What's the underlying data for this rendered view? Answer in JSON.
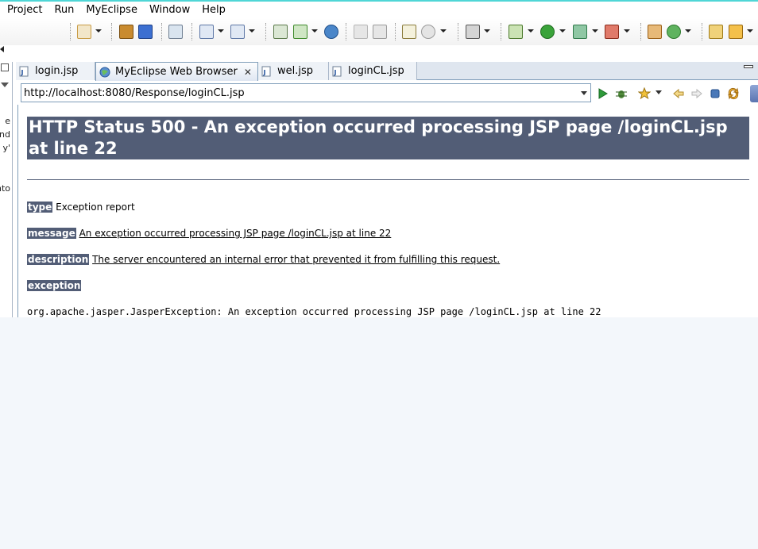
{
  "menu": [
    "Project",
    "Run",
    "MyEclipse",
    "Window",
    "Help"
  ],
  "left_panel_fragments": [
    "e",
    "nd",
    "y'",
    "nto"
  ],
  "tabs": [
    {
      "label": "login.jsp",
      "icon": "jsp-file-icon"
    },
    {
      "label": "MyEclipse Web Browser",
      "icon": "globe-icon",
      "active": true
    },
    {
      "label": "wel.jsp",
      "icon": "jsp-file-icon"
    },
    {
      "label": "loginCL.jsp",
      "icon": "jsp-file-icon"
    }
  ],
  "browser": {
    "url": "http://localhost:8080/Response/loginCL.jsp"
  },
  "page": {
    "title": "HTTP Status 500 - An exception occurred processing JSP page /loginCL.jsp at line 22",
    "type_label": "type",
    "type_value": "Exception report",
    "message_label": "message",
    "message_value": "An exception occurred processing JSP page /loginCL.jsp at line 22",
    "description_label": "description",
    "description_value": "The server encountered an internal error that prevented it from fulfilling this request.",
    "exception_label": "exception",
    "exception_text": "org.apache.jasper.JasperException: An exception occurred processing JSP page /loginCL.jsp at line 22"
  },
  "colors": {
    "tomcat_header": "#525d76",
    "accent_line": "#4fd6d6"
  }
}
